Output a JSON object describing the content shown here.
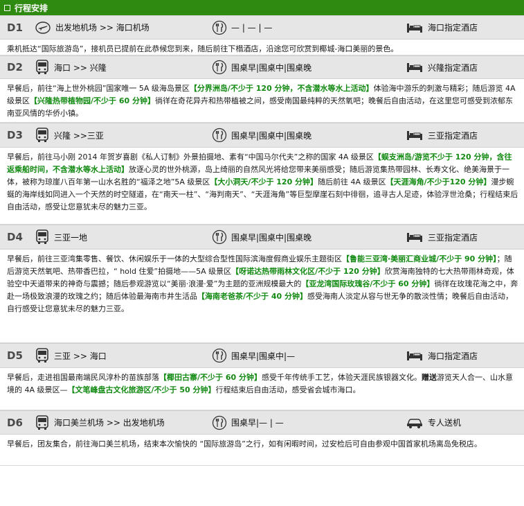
{
  "header": {
    "title": "行程安排"
  },
  "days": [
    {
      "label": "D1",
      "route": "出发地机场 >> 海口机场",
      "meals": "— | — | —",
      "hotel": "海口指定酒店",
      "desc": [
        {
          "t": "乘机抵达“国际旅游岛”，接机员已提前在此恭候您到来，随后前往下榻酒店，沿途您可欣赏到椰城-海口美丽的景色。",
          "s": ""
        }
      ]
    },
    {
      "label": "D2",
      "route": "海口 >> 兴隆",
      "meals": "围桌早|围桌中|围桌晚",
      "hotel": "兴隆指定酒店",
      "desc": [
        {
          "t": "早餐后，前往“海上世外桃园”国家唯一 5A 级海岛景区",
          "s": ""
        },
        {
          "t": "【分界洲岛/不少于 120 分钟，不含潜水等水上活动】",
          "s": "g"
        },
        {
          "t": "体验海中游乐的刺激与精彩；随后游览 4A 级景区",
          "s": ""
        },
        {
          "t": "【兴隆热带植物园/不少于 60 分钟】",
          "s": "g"
        },
        {
          "t": "徜徉在奇花异卉和热带植被之间，感受南国最纯粹的天然氧吧；晚餐后自由活动，在这里您可感受到浓郁东南亚风情的华侨小镇。",
          "s": ""
        }
      ]
    },
    {
      "label": "D3",
      "route": "兴隆 >>三亚",
      "meals": "围桌早|围桌中|围桌晚",
      "hotel": "三亚指定酒店",
      "desc": [
        {
          "t": "早餐后，前往马小刚 2014 年贺岁喜剧《私人订制》外景拍摄地、素有“中国马尔代夫”之称的国家 4A 级景区",
          "s": ""
        },
        {
          "t": "【蜈支洲岛/游览不少于 120 分钟，含往返乘船时间，不含潜水等水上活动】",
          "s": "g"
        },
        {
          "t": "放逐心灵的世外桃源，岛上绮丽的自然风光将给您带来美丽感受；随后游览集热带园林、长寿文化、绝美海景于一体，被称为琼崖八百年第一山水名胜的“福泽之地”5A 级景区",
          "s": ""
        },
        {
          "t": "【大小洞天/不少于 120 分钟】",
          "s": "g"
        },
        {
          "t": "随后前往 4A 级景区",
          "s": ""
        },
        {
          "t": "【天涯海角/不少于120 分钟】",
          "s": "g"
        },
        {
          "t": "漫步蜿蜒的海岸线如同进入一个天然的时空隧道，在“南天一柱”、“海判南天”、“天涯海角”等巨型摩崖石刻中徘徊，追寻古人足迹，体验浮世沧桑；行程结束后自由活动，感受让您意犹未尽的魅力三亚。",
          "s": ""
        }
      ]
    },
    {
      "label": "D4",
      "route": "三亚一地",
      "meals": "围桌早|围桌中|围桌晚",
      "hotel": "三亚指定酒店",
      "desc": [
        {
          "t": "早餐后，前往三亚湾集零售、餐饮、休闲娱乐于一体的大型综合型性国际滨海度假商业娱乐主题街区",
          "s": ""
        },
        {
          "t": "【鲁能三亚湾·美丽汇商业城/不少于 90 分钟】",
          "s": "g"
        },
        {
          "t": "；随后游览天然氧吧、热带香巴拉，“ hold 住爱”拍摄地——5A 级景区",
          "s": ""
        },
        {
          "t": "【呀诺达热带雨林文化区/不少于 120 分钟】",
          "s": "g"
        },
        {
          "t": "欣赏海南独特的七大热带雨林奇观，体验空中天道带来的神奇与震撼；随后参观游览以“美丽·浪漫·爱”为主题的亚洲规模最大的",
          "s": ""
        },
        {
          "t": "【亚龙湾国际玫瑰谷/不少于 60 分钟】",
          "s": "g"
        },
        {
          "t": "徜徉在玫瑰花海之中，奔赴一场极致浪漫的玫瑰之约；随后体验最海南市井生活品",
          "s": ""
        },
        {
          "t": "【海南老爸茶/不少于 40 分钟】",
          "s": "g"
        },
        {
          "t": "感受海南人淡定从容与世无争的散淡性情；晚餐后自由活动，自行感受让您意犹未尽的魅力三亚。",
          "s": ""
        }
      ]
    },
    {
      "label": "D5",
      "route": "三亚 >> 海口",
      "meals": "围桌早|围桌中|—",
      "hotel": "海口指定酒店",
      "desc": [
        {
          "t": "早餐后，走进祖国最南端民风淳朴的苗族部落",
          "s": ""
        },
        {
          "t": "【椰田古寨/不少于 60 分钟】",
          "s": "g"
        },
        {
          "t": "感受千年传统手工艺，体验天涯民族银器文化。",
          "s": ""
        },
        {
          "t": "赠送",
          "s": "b"
        },
        {
          "t": "游览天人合一、山水意境的 4A 级景区—",
          "s": ""
        },
        {
          "t": "【文笔峰盘古文化旅游区/不少于 50 分钟】",
          "s": "g"
        },
        {
          "t": "行程结束后自由活动，感受省会城市海口。",
          "s": ""
        }
      ]
    },
    {
      "label": "D6",
      "route": "海口美兰机场 >> 出发地机场",
      "meals": "围桌早|— | —",
      "hotel": "专人送机",
      "desc": [
        {
          "t": "早餐后，团友集合，前往海口美兰机场，结束本次愉快的 “国际旅游岛”之行，如有闲暇时间，过安检后可自由参观中国首家机场离岛免税店。",
          "s": ""
        }
      ]
    }
  ],
  "icons": {
    "D1": {
      "transport": "plane-icon",
      "hotel": "bed-icon"
    },
    "D2": {
      "transport": "bus-icon",
      "hotel": "bed-icon"
    },
    "D3": {
      "transport": "bus-icon",
      "hotel": "bed-icon"
    },
    "D4": {
      "transport": "bus-icon",
      "hotel": "bed-icon"
    },
    "D5": {
      "transport": "bus-icon",
      "hotel": "bed-icon"
    },
    "D6": {
      "transport": "bus-icon",
      "hotel": "car-icon"
    }
  },
  "colors": {
    "header_bg": "#2f8a12",
    "highlight": "#128a12",
    "day_bar": "#e6e6e6"
  }
}
